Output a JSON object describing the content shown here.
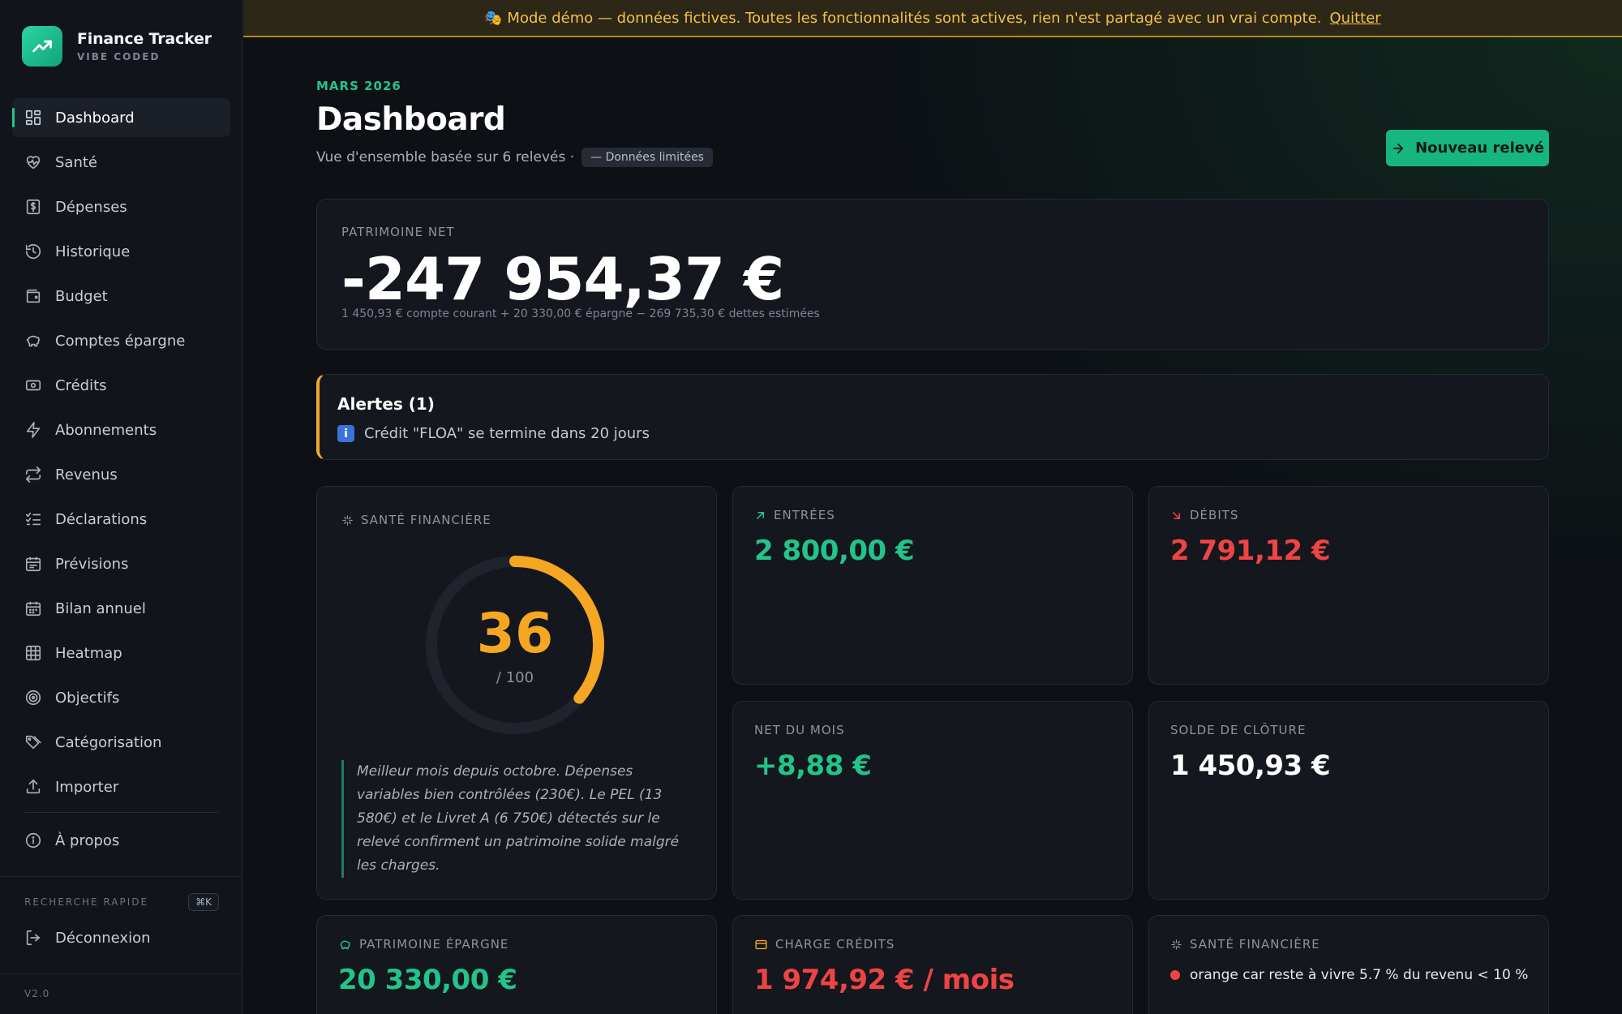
{
  "brand": {
    "name": "Finance Tracker",
    "subtitle": "VIBE CODED"
  },
  "sidebar": {
    "items": [
      {
        "label": "Dashboard",
        "icon": "dashboard-icon",
        "active": true
      },
      {
        "label": "Santé",
        "icon": "heart-pulse-icon"
      },
      {
        "label": "Dépenses",
        "icon": "dollar-receipt-icon"
      },
      {
        "label": "Historique",
        "icon": "history-icon"
      },
      {
        "label": "Budget",
        "icon": "wallet-icon"
      },
      {
        "label": "Comptes épargne",
        "icon": "piggy-bank-icon"
      },
      {
        "label": "Crédits",
        "icon": "banknote-icon"
      },
      {
        "label": "Abonnements",
        "icon": "lightning-icon"
      },
      {
        "label": "Revenus",
        "icon": "repeat-icon"
      },
      {
        "label": "Déclarations",
        "icon": "checklist-icon"
      },
      {
        "label": "Prévisions",
        "icon": "calendar-icon"
      },
      {
        "label": "Bilan annuel",
        "icon": "calendar-grid-icon"
      },
      {
        "label": "Heatmap",
        "icon": "grid-icon"
      },
      {
        "label": "Objectifs",
        "icon": "target-icon"
      },
      {
        "label": "Catégorisation",
        "icon": "tags-icon"
      },
      {
        "label": "Importer",
        "icon": "upload-icon"
      },
      {
        "label": "À propos",
        "icon": "info-circle-icon"
      }
    ],
    "quick_search_label": "RECHERCHE RAPIDE",
    "quick_search_shortcut": "⌘K",
    "logout_label": "Déconnexion",
    "version": "V2.0"
  },
  "banner": {
    "text": "🎭 Mode démo — données fictives. Toutes les fonctionnalités sont actives, rien n'est partagé avec un vrai compte.",
    "link": "Quitter"
  },
  "header": {
    "period": "MARS 2026",
    "title": "Dashboard",
    "subtitle": "Vue d'ensemble basée sur 6 relevés ·",
    "pill": "— Données limitées",
    "new_button": "Nouveau relevé"
  },
  "networth": {
    "label": "PATRIMOINE NET",
    "value": "-247 954,37 €",
    "detail": "1 450,93 € compte courant + 20 330,00 € épargne − 269 735,30 € dettes estimées"
  },
  "alerts": {
    "title": "Alertes (1)",
    "items": [
      "Crédit \"FLOA\" se termine dans 20 jours"
    ]
  },
  "health": {
    "label": "SANTÉ FINANCIÈRE",
    "score": 36,
    "score_text": "36",
    "max_text": "/ 100",
    "gauge_color": "#f5a623",
    "comment": "Meilleur mois depuis octobre. Dépenses variables bien contrôlées (230€). Le PEL (13 580€) et le Livret A (6 750€) détectés sur le relevé confirment un patrimoine solide malgré les charges."
  },
  "stats": {
    "entrees": {
      "label": "ENTRÉES",
      "value": "2 800,00 €"
    },
    "debits": {
      "label": "DÉBITS",
      "value": "2 791,12 €"
    },
    "net": {
      "label": "NET DU MOIS",
      "value": "+8,88 €"
    },
    "solde": {
      "label": "SOLDE DE CLÔTURE",
      "value": "1 450,93 €"
    },
    "epargne": {
      "label": "PATRIMOINE ÉPARGNE",
      "value": "20 330,00 €"
    },
    "credits": {
      "label": "CHARGE CRÉDITS",
      "value": "1 974,92 € / mois"
    },
    "sante": {
      "label": "SANTÉ FINANCIÈRE",
      "text": "orange car reste à vivre 5.7 % du revenu < 10 %"
    }
  }
}
